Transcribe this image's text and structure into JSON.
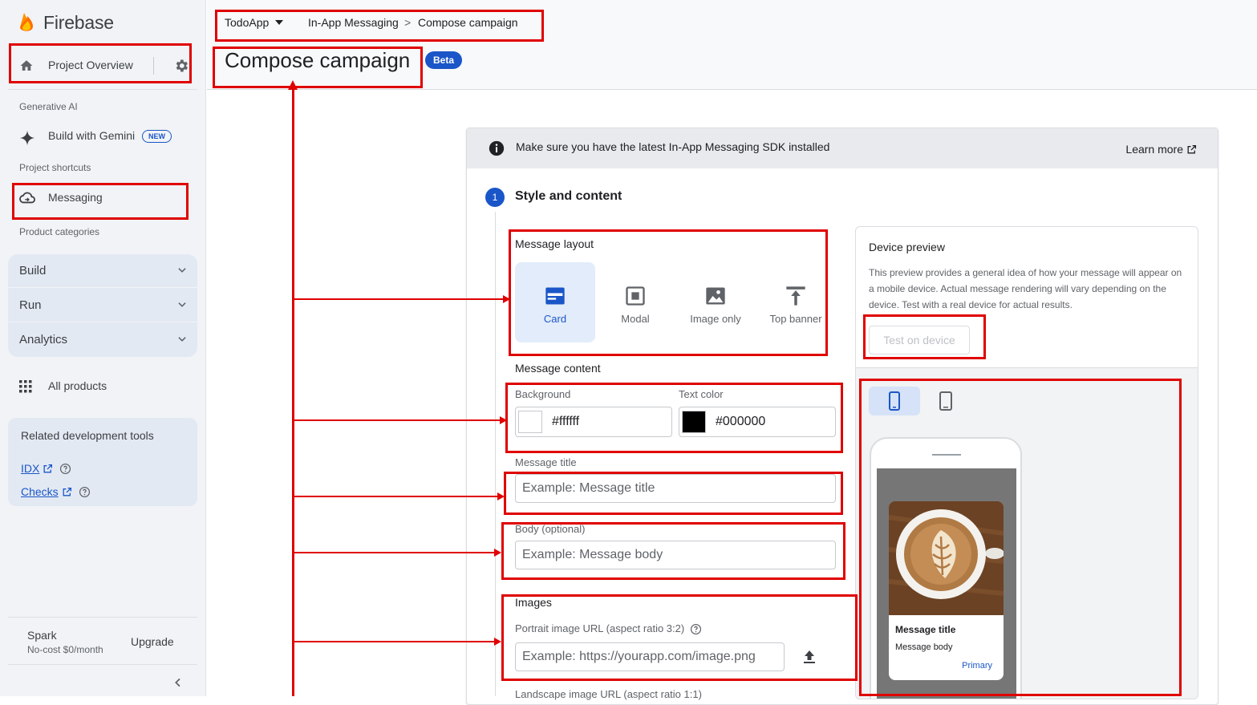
{
  "sidebar": {
    "brand": "Firebase",
    "project_overview": "Project Overview",
    "sections": {
      "generative_ai": "Generative AI",
      "project_shortcuts": "Project shortcuts",
      "product_categories": "Product categories"
    },
    "build_with_gemini": "Build with Gemini",
    "new_badge": "NEW",
    "messaging": "Messaging",
    "categories": [
      "Build",
      "Run",
      "Analytics"
    ],
    "all_products": "All products",
    "related_title": "Related development tools",
    "related_links": [
      "IDX",
      "Checks"
    ],
    "plan_name": "Spark",
    "plan_sub": "No-cost $0/month",
    "upgrade": "Upgrade"
  },
  "header": {
    "app_name": "TodoApp",
    "crumb_parent": "In-App Messaging",
    "crumb_sep": ">",
    "crumb_current": "Compose campaign",
    "title": "Compose campaign",
    "badge": "Beta"
  },
  "notice": {
    "message": "Make sure you have the latest In-App Messaging SDK installed",
    "learn_more": "Learn more"
  },
  "step": {
    "number": "1",
    "title": "Style and content"
  },
  "form": {
    "message_layout_label": "Message layout",
    "layouts": [
      "Card",
      "Modal",
      "Image only",
      "Top banner"
    ],
    "selected_layout": "Card",
    "message_content_label": "Message content",
    "background_label": "Background",
    "background_value": "#ffffff",
    "text_color_label": "Text color",
    "text_color_value": "#000000",
    "title_label": "Message title",
    "title_placeholder": "Example: Message title",
    "body_label": "Body (optional)",
    "body_placeholder": "Example: Message body",
    "images_label": "Images",
    "portrait_label": "Portrait image URL (aspect ratio 3:2)",
    "portrait_placeholder": "Example: https://yourapp.com/image.png",
    "landscape_label": "Landscape image URL (aspect ratio 1:1)"
  },
  "preview": {
    "title": "Device preview",
    "description": "This preview provides a general idea of how your message will appear on a mobile device. Actual message rendering will vary depending on the device. Test with a real device for actual results.",
    "test_button": "Test on device",
    "message_title": "Message title",
    "message_body": "Message body",
    "primary": "Primary"
  },
  "colors": {
    "accent": "#1a56c8",
    "annotation": "#e00000"
  }
}
